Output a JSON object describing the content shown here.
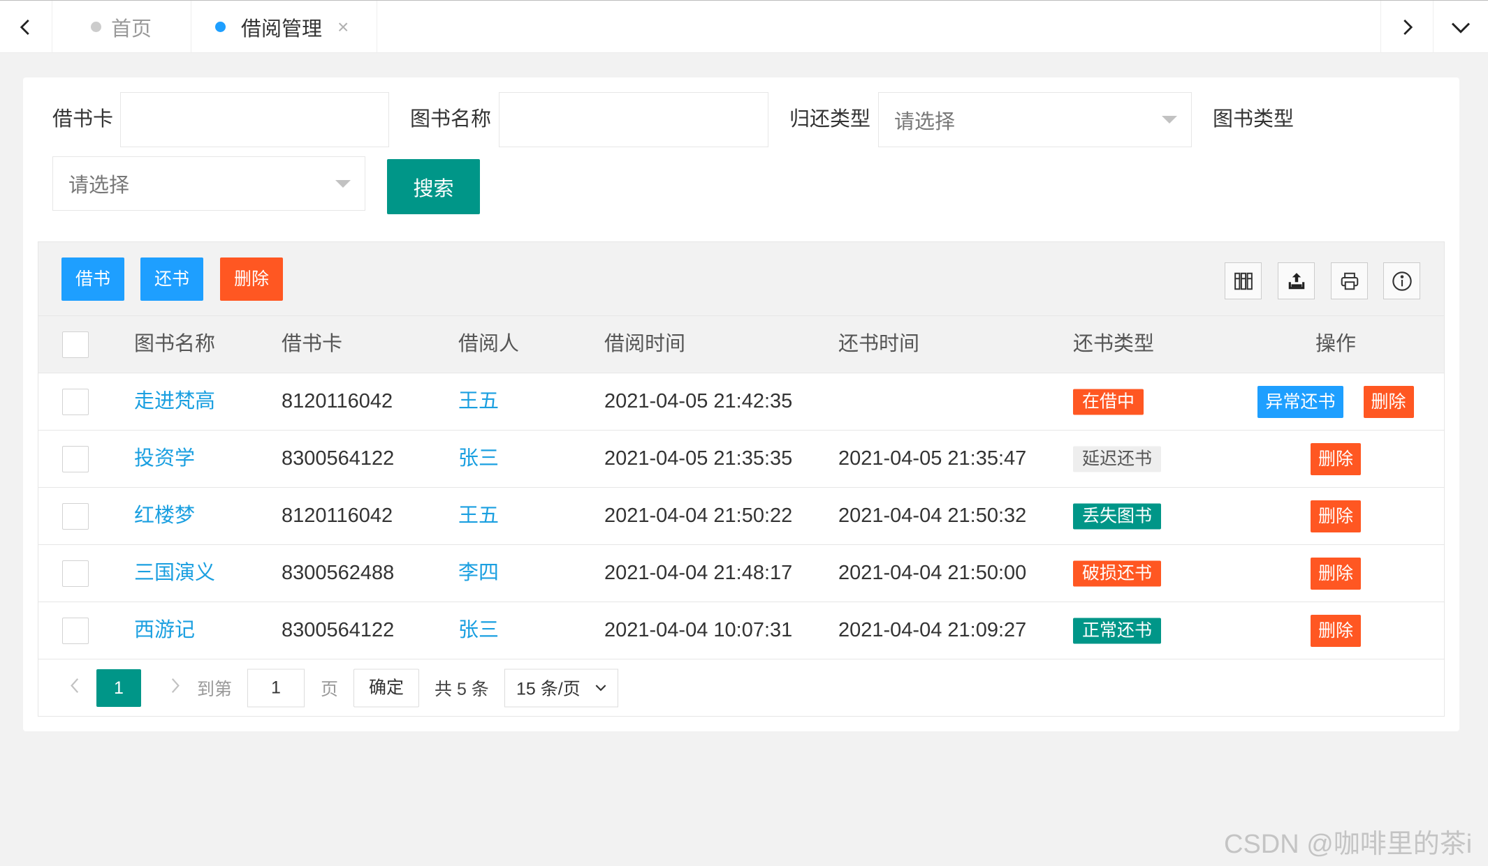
{
  "tabbar": {
    "prev_icon": "chevron-left-icon",
    "tabs": [
      {
        "label": "首页",
        "dot_color": "#cccccc"
      },
      {
        "label": "借阅管理",
        "dot_color": "#1E9FFF",
        "close_glyph": "×"
      }
    ],
    "next_icon": "chevron-right-icon",
    "menu_icon": "chevron-down-icon"
  },
  "search_form": {
    "card": {
      "label": "借书卡",
      "value": ""
    },
    "book_name": {
      "label": "图书名称",
      "value": ""
    },
    "return_type": {
      "label": "归还类型",
      "placeholder": "请选择"
    },
    "book_type": {
      "label": "图书类型",
      "placeholder": "请选择"
    },
    "search_button": "搜索"
  },
  "toolbar": {
    "borrow_button": "借书",
    "return_button": "还书",
    "delete_button": "删除",
    "icons": [
      "columns-icon",
      "export-icon",
      "print-icon",
      "info-icon"
    ]
  },
  "table": {
    "columns": [
      "图书名称",
      "借书卡",
      "借阅人",
      "借阅时间",
      "还书时间",
      "还书类型",
      "操作"
    ],
    "rows": [
      {
        "book": "走进梵高",
        "card": "8120116042",
        "borrower": "王五",
        "borrow_time": "2021-04-05 21:42:35",
        "return_time": "",
        "status": {
          "label": "在借中",
          "bg": "#FF5722",
          "fg": "#ffffff"
        },
        "actions": [
          {
            "label": "异常还书",
            "bg": "#1E9FFF"
          },
          {
            "label": "删除",
            "bg": "#FF5722"
          }
        ]
      },
      {
        "book": "投资学",
        "card": "8300564122",
        "borrower": "张三",
        "borrow_time": "2021-04-05 21:35:35",
        "return_time": "2021-04-05 21:35:47",
        "status": {
          "label": "延迟还书",
          "bg": "#eeeeee",
          "fg": "#555555"
        },
        "actions": [
          {
            "label": "删除",
            "bg": "#FF5722"
          }
        ]
      },
      {
        "book": "红楼梦",
        "card": "8120116042",
        "borrower": "王五",
        "borrow_time": "2021-04-04 21:50:22",
        "return_time": "2021-04-04 21:50:32",
        "status": {
          "label": "丢失图书",
          "bg": "#009688",
          "fg": "#ffffff"
        },
        "actions": [
          {
            "label": "删除",
            "bg": "#FF5722"
          }
        ]
      },
      {
        "book": "三国演义",
        "card": "8300562488",
        "borrower": "李四",
        "borrow_time": "2021-04-04 21:48:17",
        "return_time": "2021-04-04 21:50:00",
        "status": {
          "label": "破损还书",
          "bg": "#FF5722",
          "fg": "#ffffff"
        },
        "actions": [
          {
            "label": "删除",
            "bg": "#FF5722"
          }
        ]
      },
      {
        "book": "西游记",
        "card": "8300564122",
        "borrower": "张三",
        "borrow_time": "2021-04-04 10:07:31",
        "return_time": "2021-04-04 21:09:27",
        "status": {
          "label": "正常还书",
          "bg": "#009688",
          "fg": "#ffffff"
        },
        "actions": [
          {
            "label": "删除",
            "bg": "#FF5722"
          }
        ]
      }
    ]
  },
  "pagination": {
    "prev_icon": "chevron-left-icon",
    "current_page": "1",
    "next_icon": "chevron-right-icon",
    "goto_label": "到第",
    "goto_value": "1",
    "page_unit": "页",
    "confirm_button": "确定",
    "total": "共 5 条",
    "page_size": "15 条/页"
  },
  "watermark": "CSDN @咖啡里的茶i",
  "colors": {
    "primary": "#009688",
    "normal": "#1E9FFF",
    "danger": "#FF5722",
    "link": "#1a9fe0",
    "page_bg": "#f2f2f2"
  }
}
